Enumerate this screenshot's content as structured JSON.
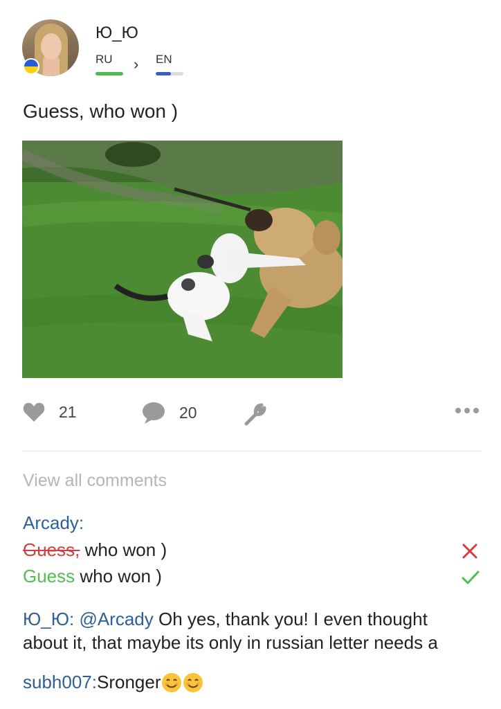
{
  "post": {
    "author": "Ю_Ю",
    "lang_from": "RU",
    "lang_arrow": "›",
    "lang_to": "EN",
    "lang_from_progress": 1.0,
    "lang_to_progress": 0.55,
    "text": "Guess, who won )",
    "photo_description": "kitten-and-puppy-playing-on-grass"
  },
  "actions": {
    "likes": "21",
    "comments": "20",
    "like_icon": "heart-icon",
    "comment_icon": "speech-bubble-icon",
    "edit_icon": "wrench-icon",
    "more_icon": "more-dots-icon"
  },
  "comments": {
    "view_all": "View all comments",
    "correction": {
      "author": "Arcady:",
      "wrong_strike": "Guess,",
      "wrong_rest": " who won )",
      "right_good": "Guess",
      "right_rest": " who won )"
    },
    "reply": {
      "author": "Ю_Ю:",
      "mention": " @Arcady",
      "line1_rest": " Oh yes, thank you! I even thought",
      "line2": "about it, that maybe its only in russian letter needs a"
    },
    "sub": {
      "author": "subh007:",
      "text": " Sronger"
    }
  },
  "colors": {
    "link": "#2e5f95",
    "correct": "#4fbf4f",
    "wrong": "#d83b3b",
    "lang_from_bar": "#4cbb4a",
    "lang_to_bar": "#3b5eb7"
  }
}
